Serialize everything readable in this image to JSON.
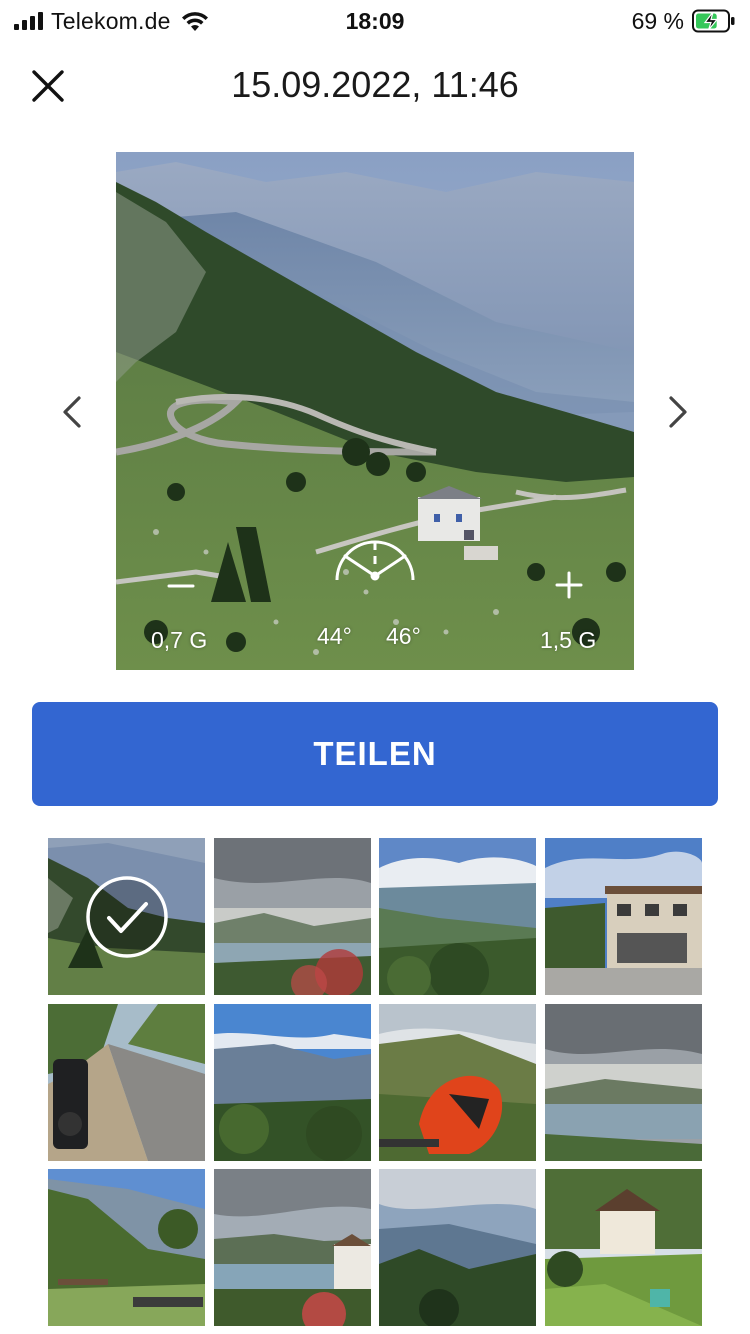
{
  "status_bar": {
    "carrier": "Telekom.de",
    "time": "18:09",
    "battery_percent": "69 %",
    "icons": [
      "signal-icon",
      "wifi-icon",
      "battery-charging-icon"
    ],
    "battery_level": 0.69
  },
  "header": {
    "title": "15.09.2022, 11:46",
    "close_icon": "close-icon"
  },
  "viewer": {
    "prev_icon": "chevron-left-icon",
    "next_icon": "chevron-right-icon",
    "gain_min_label": "0,7 G",
    "gain_max_label": "1,5 G",
    "angle_left_label": "44°",
    "angle_right_label": "46°",
    "minus_icon": "minus-icon",
    "plus_icon": "plus-icon",
    "angle_gauge_icon": "lean-angle-gauge-icon"
  },
  "share_button": {
    "label": "TEILEN"
  },
  "thumbnails": [
    {
      "id": "t1",
      "selected": true,
      "scene": "mountain-valley"
    },
    {
      "id": "t2",
      "selected": false,
      "scene": "cloudy-lake"
    },
    {
      "id": "t3",
      "selected": false,
      "scene": "blue-sky-valley"
    },
    {
      "id": "t4",
      "selected": false,
      "scene": "building"
    },
    {
      "id": "t5",
      "selected": false,
      "scene": "road-motorcycle"
    },
    {
      "id": "t6",
      "selected": false,
      "scene": "mountains-trees"
    },
    {
      "id": "t7",
      "selected": false,
      "scene": "helmet"
    },
    {
      "id": "t8",
      "selected": false,
      "scene": "cloudy-lake-2"
    },
    {
      "id": "t9",
      "selected": false,
      "scene": "green-hillside"
    },
    {
      "id": "t10",
      "selected": false,
      "scene": "lake-village"
    },
    {
      "id": "t11",
      "selected": false,
      "scene": "forest-valley"
    },
    {
      "id": "t12",
      "selected": false,
      "scene": "house-garden"
    }
  ],
  "colors": {
    "accent": "#3366d1",
    "text": "#1a1a1a",
    "background": "#ffffff"
  }
}
